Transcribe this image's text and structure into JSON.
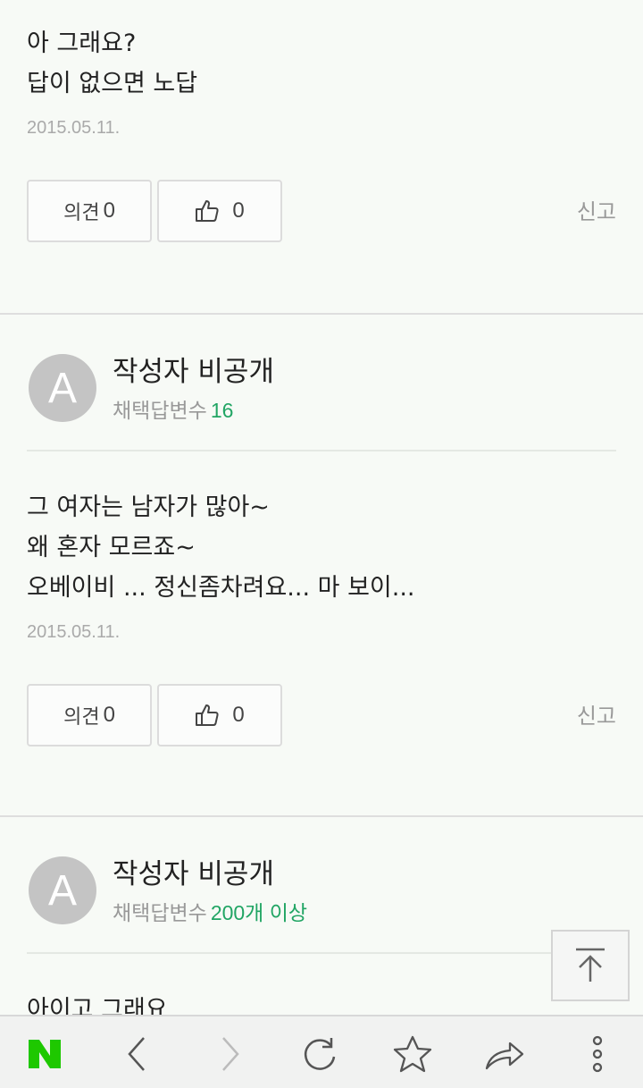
{
  "answers": [
    {
      "body_lines": [
        "아 그래요?",
        "답이 없으면 노답"
      ],
      "date": "2015.05.11.",
      "comment_label": "의견",
      "comment_count": "0",
      "like_count": "0",
      "report_label": "신고"
    },
    {
      "author_initial": "A",
      "author_name": "작성자 비공개",
      "meta_label": "채택답변수",
      "meta_count": "16",
      "body_lines": [
        "그 여자는 남자가 많아~",
        "왜 혼자 모르죠~",
        "오베이비 ... 정신좀차려요... 마 보이..."
      ],
      "date": "2015.05.11.",
      "comment_label": "의견",
      "comment_count": "0",
      "like_count": "0",
      "report_label": "신고"
    },
    {
      "author_initial": "A",
      "author_name": "작성자 비공개",
      "meta_label": "채택답변수",
      "meta_count": "200개 이상",
      "body_lines": [
        "아이고 그래요"
      ]
    }
  ],
  "bottom_bar": {
    "logo": "N",
    "items": [
      "naver-logo",
      "back-icon",
      "forward-icon",
      "refresh-icon",
      "bookmark-star-icon",
      "share-icon",
      "more-vertical-icon"
    ],
    "logo_color": "#1ec800"
  },
  "accent_color": "#21a564"
}
